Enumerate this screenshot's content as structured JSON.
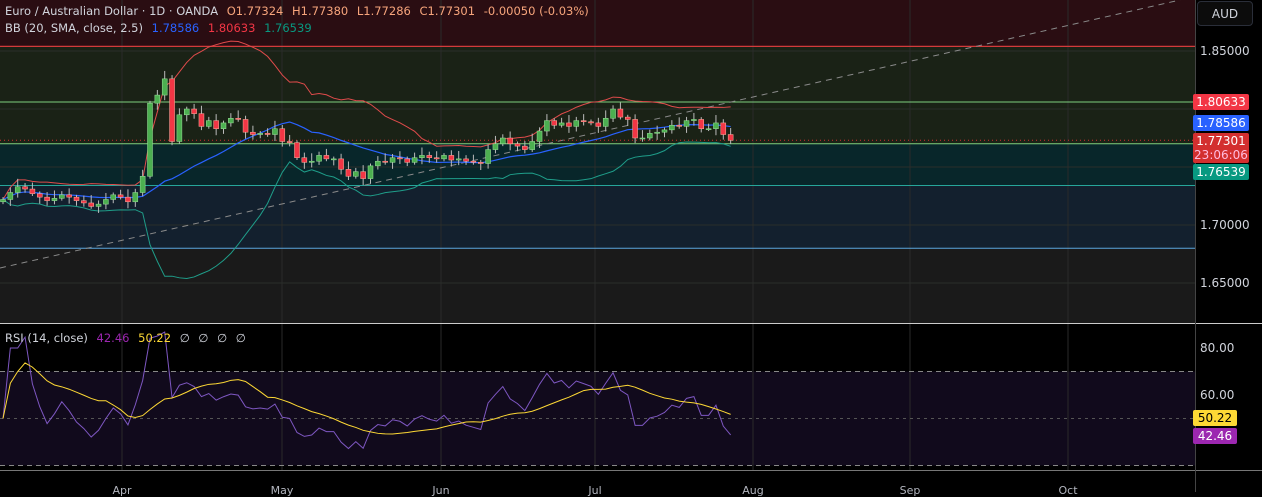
{
  "header": {
    "symbol": "Euro / Australian Dollar · 1D · OANDA",
    "open": "O1.77324",
    "high": "H1.77380",
    "low": "L1.77286",
    "close": "C1.77301",
    "change": "-0.00050 (-0.03%)"
  },
  "bb": {
    "label": "BB (20, SMA, close, 2.5)",
    "basis": "1.78586",
    "upper": "1.80633",
    "lower": "1.76539"
  },
  "rsi": {
    "label": "RSI (14, close)",
    "value": "42.46",
    "ma": "50.22",
    "extras": [
      "∅",
      "∅",
      "∅",
      "∅"
    ]
  },
  "currency_button": "AUD",
  "price_axis": {
    "labels": [
      "1.85000",
      "1.70000",
      "1.65000"
    ],
    "tags": {
      "upper": "1.80633",
      "basis": "1.78586",
      "last": "1.77301",
      "countdown": "23:06:06",
      "lower": "1.76539"
    }
  },
  "rsi_axis": {
    "labels": [
      "80.00",
      "60.00"
    ],
    "tags": {
      "ma": "50.22",
      "rsi": "42.46"
    }
  },
  "time_axis": [
    "Apr",
    "May",
    "Jun",
    "Jul",
    "Aug",
    "Sep",
    "Oct"
  ],
  "colors": {
    "up": "#4caf50",
    "down": "#f23645",
    "basis": "#2962ff",
    "upper": "#f23645",
    "lower": "#089981",
    "rsi": "#7e57c2",
    "rsi_ma": "#fdd835"
  },
  "chart_data": {
    "type": "candlestick",
    "price_range": [
      1.62,
      1.87
    ],
    "closes": [
      1.722,
      1.728,
      1.733,
      1.731,
      1.727,
      1.724,
      1.721,
      1.723,
      1.726,
      1.724,
      1.721,
      1.719,
      1.716,
      1.718,
      1.722,
      1.726,
      1.724,
      1.72,
      1.728,
      1.742,
      1.805,
      1.812,
      1.826,
      1.772,
      1.795,
      1.8,
      1.796,
      1.785,
      1.79,
      1.783,
      1.788,
      1.792,
      1.791,
      1.78,
      1.778,
      1.779,
      1.778,
      1.783,
      1.772,
      1.771,
      1.758,
      1.754,
      1.755,
      1.76,
      1.757,
      1.757,
      1.748,
      1.742,
      1.746,
      1.74,
      1.751,
      1.755,
      1.754,
      1.758,
      1.757,
      1.754,
      1.758,
      1.76,
      1.758,
      1.757,
      1.76,
      1.756,
      1.757,
      1.755,
      1.754,
      1.753,
      1.765,
      1.77,
      1.775,
      1.77,
      1.768,
      1.765,
      1.772,
      1.781,
      1.79,
      1.786,
      1.788,
      1.785,
      1.79,
      1.789,
      1.788,
      1.785,
      1.792,
      1.8,
      1.793,
      1.791,
      1.775,
      1.775,
      1.779,
      1.78,
      1.782,
      1.786,
      1.785,
      1.79,
      1.791,
      1.783,
      1.783,
      1.788,
      1.778,
      1.77301
    ],
    "zones": [
      1.854,
      1.806,
      1.77,
      1.734,
      1.68
    ]
  }
}
